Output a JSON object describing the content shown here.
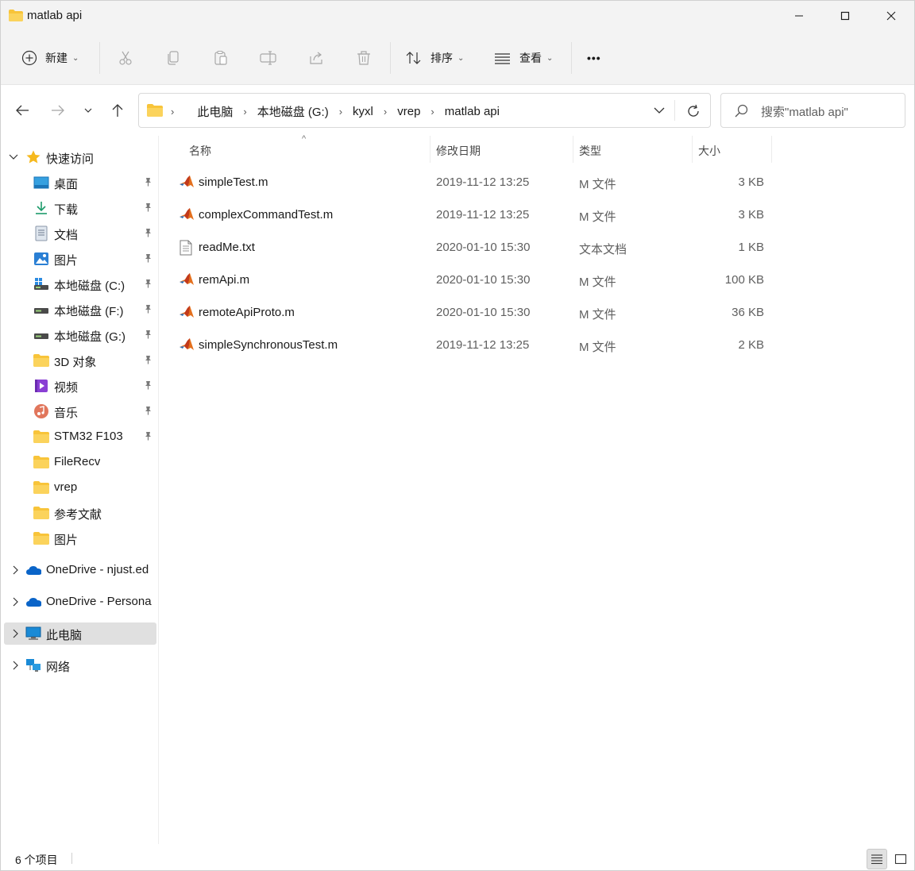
{
  "window": {
    "title": "matlab api",
    "controls": [
      "minimize",
      "maximize",
      "close"
    ]
  },
  "commandbar": {
    "new_label": "新建",
    "sort_label": "排序",
    "view_label": "查看",
    "more_label": "•••",
    "icons": [
      "cut-icon",
      "copy-icon",
      "paste-icon",
      "rename-icon",
      "share-icon",
      "delete-icon"
    ]
  },
  "address": {
    "breadcrumbs": [
      "此电脑",
      "本地磁盘 (G:)",
      "kyxl",
      "vrep",
      "matlab api"
    ]
  },
  "search": {
    "placeholder": "搜索\"matlab api\""
  },
  "sidebar": {
    "quick_access": "快速访问",
    "items": [
      {
        "label": "桌面",
        "icon": "desktop-icon",
        "pinned": true
      },
      {
        "label": "下载",
        "icon": "download-icon",
        "pinned": true
      },
      {
        "label": "文档",
        "icon": "document-icon",
        "pinned": true
      },
      {
        "label": "图片",
        "icon": "pictures-icon",
        "pinned": true
      },
      {
        "label": "本地磁盘 (C:)",
        "icon": "drive-c-icon",
        "pinned": true
      },
      {
        "label": "本地磁盘 (F:)",
        "icon": "drive-icon",
        "pinned": true
      },
      {
        "label": "本地磁盘 (G:)",
        "icon": "drive-icon",
        "pinned": true
      },
      {
        "label": "3D 对象",
        "icon": "folder-icon",
        "pinned": true
      },
      {
        "label": "视频",
        "icon": "video-icon",
        "pinned": true
      },
      {
        "label": "音乐",
        "icon": "music-icon",
        "pinned": true
      },
      {
        "label": "STM32 F103",
        "icon": "folder-icon",
        "pinned": true
      },
      {
        "label": "FileRecv",
        "icon": "folder-icon",
        "pinned": false
      },
      {
        "label": "vrep",
        "icon": "folder-icon",
        "pinned": false
      },
      {
        "label": "参考文献",
        "icon": "folder-icon",
        "pinned": false
      },
      {
        "label": "图片",
        "icon": "folder-icon",
        "pinned": false
      }
    ],
    "onedrive_work": "OneDrive - njust.ed",
    "onedrive_personal": "OneDrive - Persona",
    "this_pc": "此电脑",
    "network": "网络"
  },
  "columns": {
    "name": "名称",
    "date": "修改日期",
    "type": "类型",
    "size": "大小"
  },
  "files": [
    {
      "name": "simpleTest.m",
      "date": "2019-11-12 13:25",
      "type": "M 文件",
      "size": "3 KB",
      "icon": "matlab-icon"
    },
    {
      "name": "complexCommandTest.m",
      "date": "2019-11-12 13:25",
      "type": "M 文件",
      "size": "3 KB",
      "icon": "matlab-icon"
    },
    {
      "name": "readMe.txt",
      "date": "2020-01-10 15:30",
      "type": "文本文档",
      "size": "1 KB",
      "icon": "text-file-icon"
    },
    {
      "name": "remApi.m",
      "date": "2020-01-10 15:30",
      "type": "M 文件",
      "size": "100 KB",
      "icon": "matlab-icon"
    },
    {
      "name": "remoteApiProto.m",
      "date": "2020-01-10 15:30",
      "type": "M 文件",
      "size": "36 KB",
      "icon": "matlab-icon"
    },
    {
      "name": "simpleSynchronousTest.m",
      "date": "2019-11-12 13:25",
      "type": "M 文件",
      "size": "2 KB",
      "icon": "matlab-icon"
    }
  ],
  "status": {
    "item_count": "6 个项目"
  },
  "colors": {
    "folder_yellow": "#f8c43a",
    "selected_bg": "#e0e0e0",
    "accent_blue": "#0067c0"
  }
}
